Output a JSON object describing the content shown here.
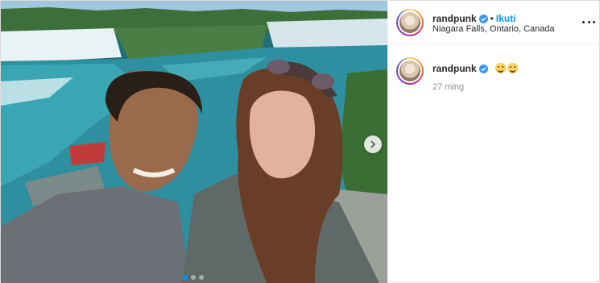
{
  "post": {
    "photo": {
      "description_icon": "photo",
      "carousel_dots": 3,
      "active_dot_index": 0
    },
    "header": {
      "username": "randpunk",
      "verified": true,
      "separator": "•",
      "follow_label": "Ikuti",
      "location": "Niagara Falls, Ontario, Canada"
    },
    "comment": {
      "username": "randpunk",
      "verified": true,
      "emojis": [
        "smiling-face-with-hands-emoji",
        "smiling-face-with-hands-emoji"
      ],
      "time_ago": "27 ming"
    }
  },
  "colors": {
    "link": "#0095f6",
    "text": "#262626",
    "muted": "#8e8e8e",
    "border": "#dbdbdb"
  }
}
